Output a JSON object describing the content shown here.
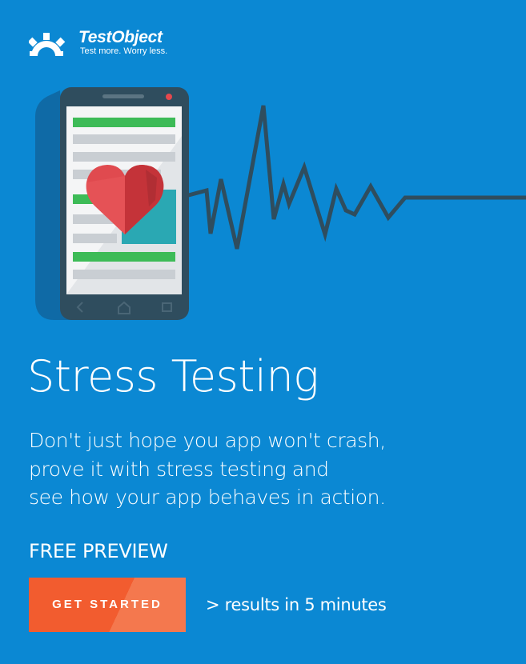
{
  "brand": {
    "name": "TestObject",
    "tagline": "Test more. Worry less.",
    "logo_icon": "gear-icon"
  },
  "illustration": {
    "phone_icon": "smartphone-icon",
    "heart_icon": "heart-icon",
    "pulse_icon": "heartbeat-line-icon"
  },
  "headline": "Stress Testing",
  "description_lines": [
    "Don't just hope you app won't crash,",
    "prove it with stress testing and",
    "see how your app behaves in action."
  ],
  "preview_label": "FREE PREVIEW",
  "cta": {
    "label": "GET STARTED",
    "note": "> results in 5 minutes"
  },
  "colors": {
    "background": "#0b88d3",
    "button": "#f25c2f",
    "phone_body": "#2f4d5e",
    "heart": "#e04a4f",
    "bar_green": "#3dbb57",
    "bar_gray": "#c9ced3",
    "teal_block": "#2aa8b3"
  }
}
